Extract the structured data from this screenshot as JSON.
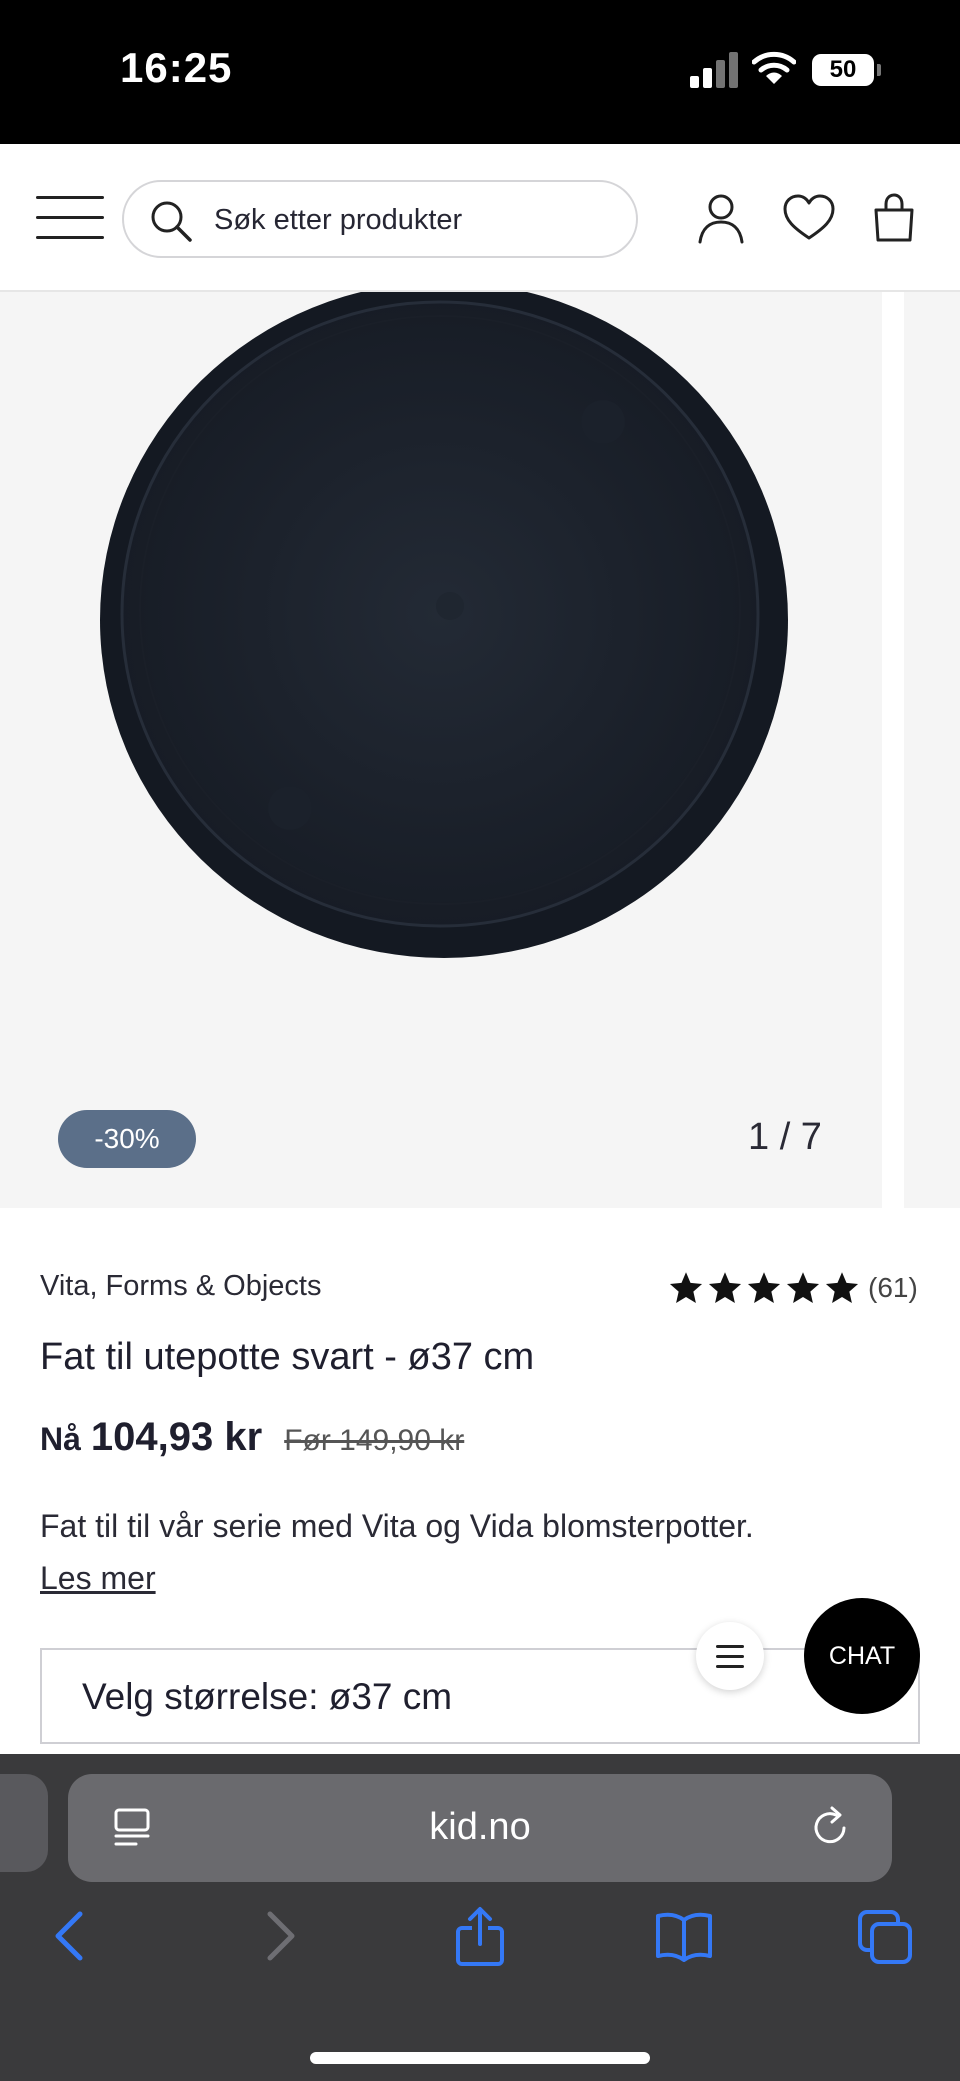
{
  "status_bar": {
    "time": "16:25",
    "battery": "50"
  },
  "header": {
    "search_placeholder": "Søk etter produkter",
    "icons": [
      "menu-icon",
      "search-icon",
      "user-icon",
      "heart-icon",
      "bag-icon"
    ]
  },
  "gallery": {
    "badge": "-30%",
    "counter": "1 / 7"
  },
  "product": {
    "brand": "Vita, Forms & Objects",
    "rating_count": "(61)",
    "rating_stars": 5,
    "title": "Fat til utepotte svart - ø37 cm",
    "price_prefix": "Nå",
    "price_now": "104,93 kr",
    "price_before": "Før 149,90 kr",
    "description": "Fat til til vår serie med Vita og Vida blomsterpotter.",
    "read_more": "Les mer",
    "size_label": "Velg størrelse: ø37 cm"
  },
  "chat": {
    "label": "CHAT"
  },
  "browser": {
    "url": "kid.no"
  },
  "colors": {
    "badge": "#5b6f89",
    "chat": "#000000",
    "safari_bar": "#3a3a3c",
    "accent": "#3478f6"
  }
}
